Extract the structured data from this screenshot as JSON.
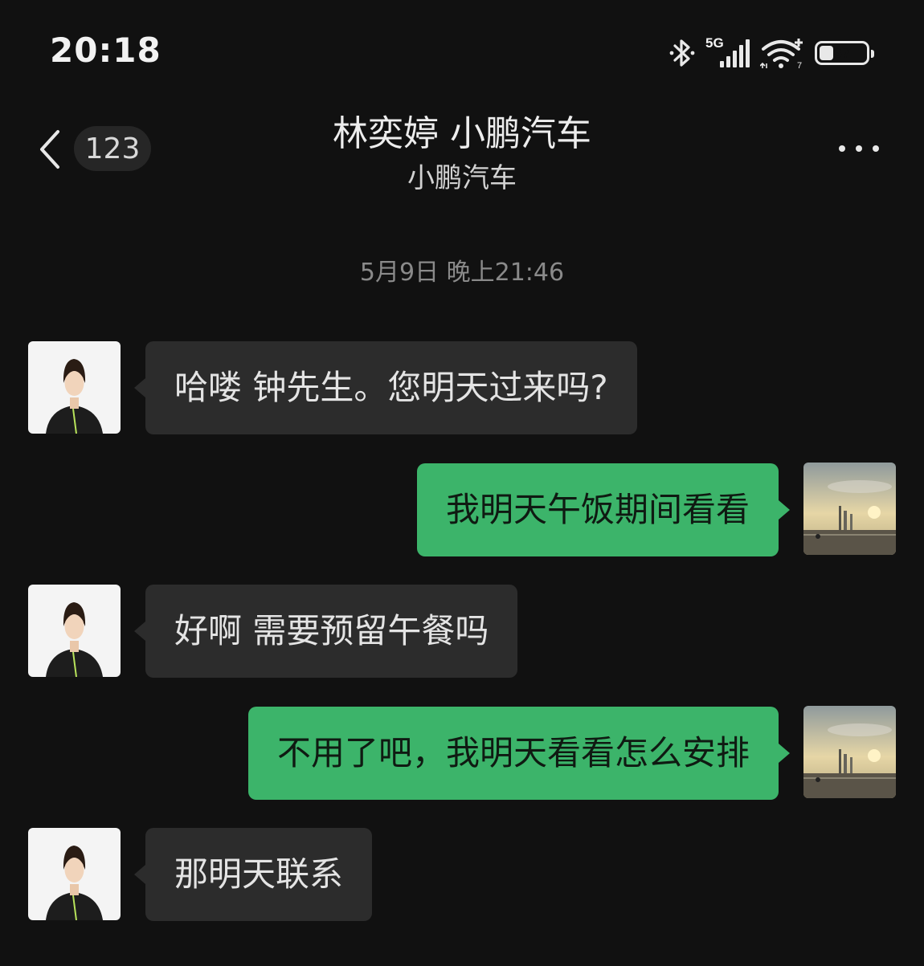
{
  "status_bar": {
    "time": "20:18",
    "network_label": "5G",
    "battery": "37",
    "battery_level": 0.37
  },
  "header": {
    "unread_count": "123",
    "title": "林奕婷 小鹏汽车",
    "subtitle": "小鹏汽车"
  },
  "timestamp": "5月9日 晚上21:46",
  "messages": [
    {
      "side": "in",
      "text": "哈喽 钟先生。您明天过来吗?"
    },
    {
      "side": "out",
      "text": "我明天午饭期间看看"
    },
    {
      "side": "in",
      "text": "好啊 需要预留午餐吗"
    },
    {
      "side": "out",
      "text": "不用了吧，我明天看看怎么安排"
    },
    {
      "side": "in",
      "text": "那明天联系"
    }
  ],
  "colors": {
    "background": "#111111",
    "incoming_bubble": "#2c2c2c",
    "outgoing_bubble": "#3cb46a"
  }
}
